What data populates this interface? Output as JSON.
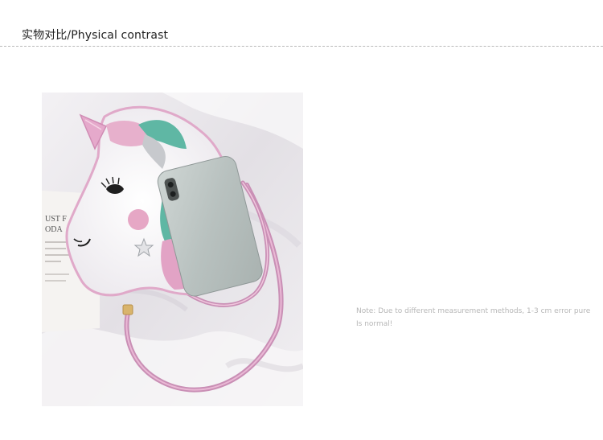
{
  "header": {
    "title": "实物对比/Physical contrast"
  },
  "photo": {
    "subject": "unicorn-crossbody-bag-with-phone",
    "card_text_line1": "UST F",
    "card_text_line2": "ODA"
  },
  "note": {
    "line1": "Note: Due to different measurement methods, 1-3 cm error pure",
    "line2": "Is normal!"
  },
  "colors": {
    "title": "#222222",
    "note": "#b7b7b7",
    "divider": "#b9b9b9",
    "bag_pink": "#e4a6c6",
    "bag_white": "#f4f2f3",
    "bag_mint": "#5fb7a4"
  }
}
